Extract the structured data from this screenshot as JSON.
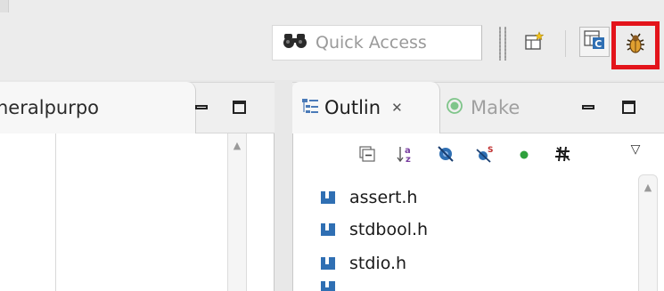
{
  "toolbar": {
    "quick_access_placeholder": "Quick Access",
    "icons": [
      "binoculars-icon",
      "open-perspective-icon",
      "c-cpp-perspective-icon",
      "debug-perspective-icon"
    ],
    "highlight_color": "#e3141b"
  },
  "left_view": {
    "tab_title": "neralpurpo"
  },
  "outline_view": {
    "tab_title": "Outlin",
    "other_tab_title": "Make",
    "toolbar_icons": [
      "collapse-all-icon",
      "sort-az-icon",
      "hide-fields-icon",
      "hide-static-icon",
      "hide-non-public-icon",
      "hide-includes-icon",
      "view-menu-icon"
    ],
    "items": [
      {
        "label": "assert.h"
      },
      {
        "label": "stdbool.h"
      },
      {
        "label": "stdio.h"
      }
    ]
  }
}
